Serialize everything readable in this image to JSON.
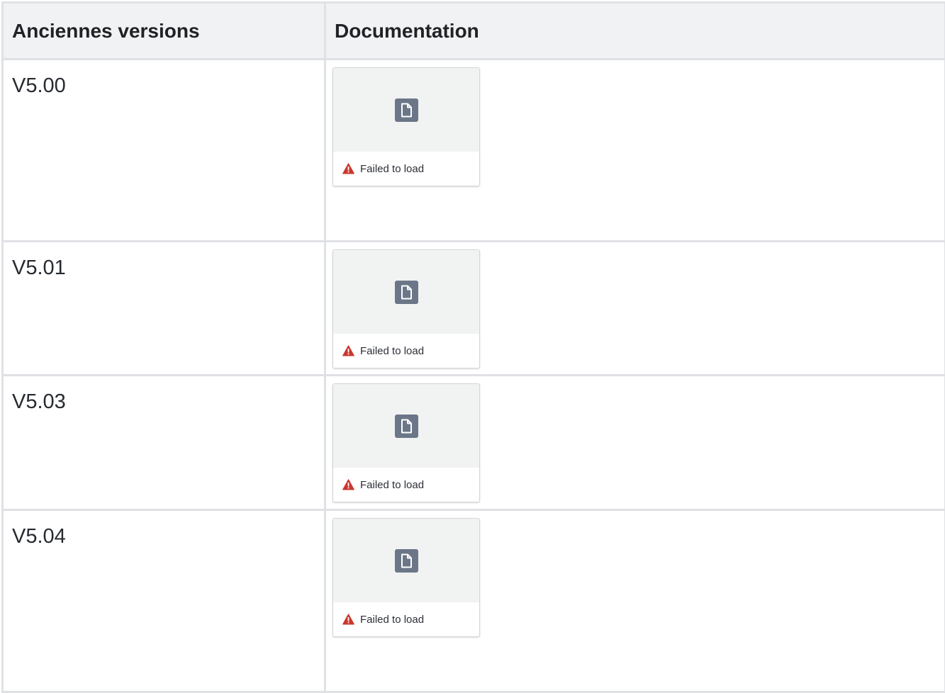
{
  "table": {
    "headers": [
      "Anciennes versions",
      "Documentation"
    ],
    "rows": [
      {
        "version": "V5.00",
        "attachment_status": "Failed to load",
        "attachment_icon": "file-icon"
      },
      {
        "version": "V5.01",
        "attachment_status": "Failed to load",
        "attachment_icon": "file-icon"
      },
      {
        "version": "V5.03",
        "attachment_status": "Failed to load",
        "attachment_icon": "file-icon"
      },
      {
        "version": "V5.04",
        "attachment_status": "Failed to load",
        "attachment_icon": "file-icon"
      }
    ]
  },
  "colors": {
    "header_bg": "#f1f2f4",
    "border": "#dfe1e4",
    "icon_bg": "#6b7688",
    "warning": "#c9372c"
  }
}
